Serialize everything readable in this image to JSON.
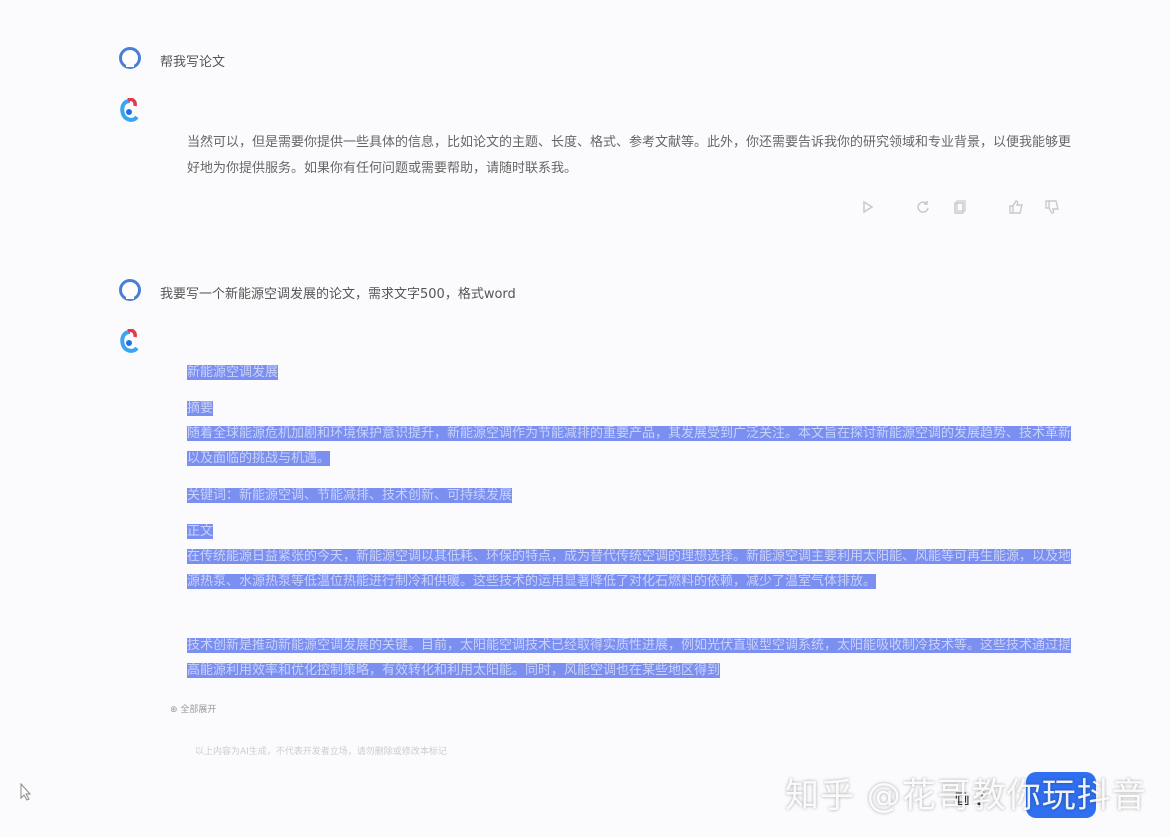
{
  "conversation": {
    "q1": "帮我写论文",
    "a1": "当然可以，但是需要你提供一些具体的信息，比如论文的主题、长度、格式、参考文献等。此外，你还需要告诉我你的研究领域和专业背景，以便我能够更好地为你提供服务。如果你有任何问题或需要帮助，请随时联系我。",
    "q2": "我要写一个新能源空调发展的论文，需求文字500，格式word",
    "doc": {
      "title": "新能源空调发展",
      "abstract_heading": "摘要",
      "abstract": "随着全球能源危机加剧和环境保护意识提升，新能源空调作为节能减排的重要产品，其发展受到广泛关注。本文旨在探讨新能源空调的发展趋势、技术革新以及面临的挑战与机遇。",
      "keywords": "关键词：新能源空调、节能减排、技术创新、可持续发展",
      "body_heading": "正文",
      "body_p1": "在传统能源日益紧张的今天，新能源空调以其低耗、环保的特点，成为替代传统空调的理想选择。新能源空调主要利用太阳能、风能等可再生能源，以及地源热泵、水源热泵等低温位热能进行制冷和供暖。这些技术的运用显著降低了对化石燃料的依赖，减少了温室气体排放。",
      "body_p2": "技术创新是推动新能源空调发展的关键。目前，太阳能空调技术已经取得实质性进展，例如光伏直驱型空调系统，太阳能吸收制冷技术等。这些技术通过提高能源利用效率和优化控制策略，有效转化和利用太阳能。同时，风能空调也在某些地区得到"
    },
    "expand_label": "全部展开",
    "footer_hint": "以上内容为AI生成，不代表开发者立场，请勿删除或修改本标记"
  },
  "watermark": "知乎 @花哥教你玩抖音",
  "icons": {
    "play": "play-icon",
    "refresh": "refresh-icon",
    "copy": "copy-icon",
    "like": "thumbs-up-icon",
    "dislike": "thumbs-down-icon"
  },
  "colors": {
    "highlight": "#7b8ff0",
    "accent": "#2f6ff0"
  }
}
